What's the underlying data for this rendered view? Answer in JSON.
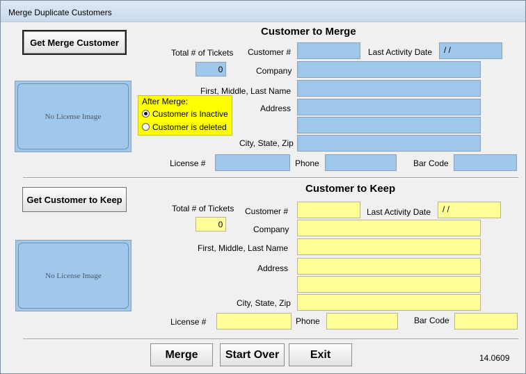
{
  "window": {
    "title": "Merge Duplicate Customers"
  },
  "merge": {
    "get_button": "Get Merge Customer",
    "heading": "Customer to Merge",
    "total_tickets_label": "Total # of Tickets",
    "total_tickets": "0",
    "license_image_text": "No License Image",
    "labels": {
      "customer_no": "Customer #",
      "last_activity": "Last Activity Date",
      "company": "Company",
      "name": "First, Middle, Last Name",
      "address": "Address",
      "city": "City, State, Zip",
      "license": "License #",
      "phone": "Phone",
      "barcode": "Bar Code"
    },
    "last_activity_value": " / /",
    "after_merge": {
      "label": "After Merge:",
      "options": [
        "Customer is Inactive",
        "Customer is deleted"
      ],
      "selected": "Customer is Inactive"
    }
  },
  "keep": {
    "get_button": "Get Customer to Keep",
    "heading": "Customer to Keep",
    "total_tickets_label": "Total # of Tickets",
    "total_tickets": "0",
    "license_image_text": "No License Image",
    "labels": {
      "customer_no": "Customer #",
      "last_activity": "Last Activity Date",
      "company": "Company",
      "name": "First, Middle, Last Name",
      "address": "Address",
      "city": "City, State, Zip",
      "license": "License #",
      "phone": "Phone",
      "barcode": "Bar Code"
    },
    "last_activity_value": " / /"
  },
  "actions": {
    "merge": "Merge",
    "start_over": "Start Over",
    "exit": "Exit"
  },
  "version": "14.0609",
  "colors": {
    "merge_field": "#9fc8ea",
    "keep_field": "#ffff99",
    "after_merge_bg": "#ffff00"
  }
}
